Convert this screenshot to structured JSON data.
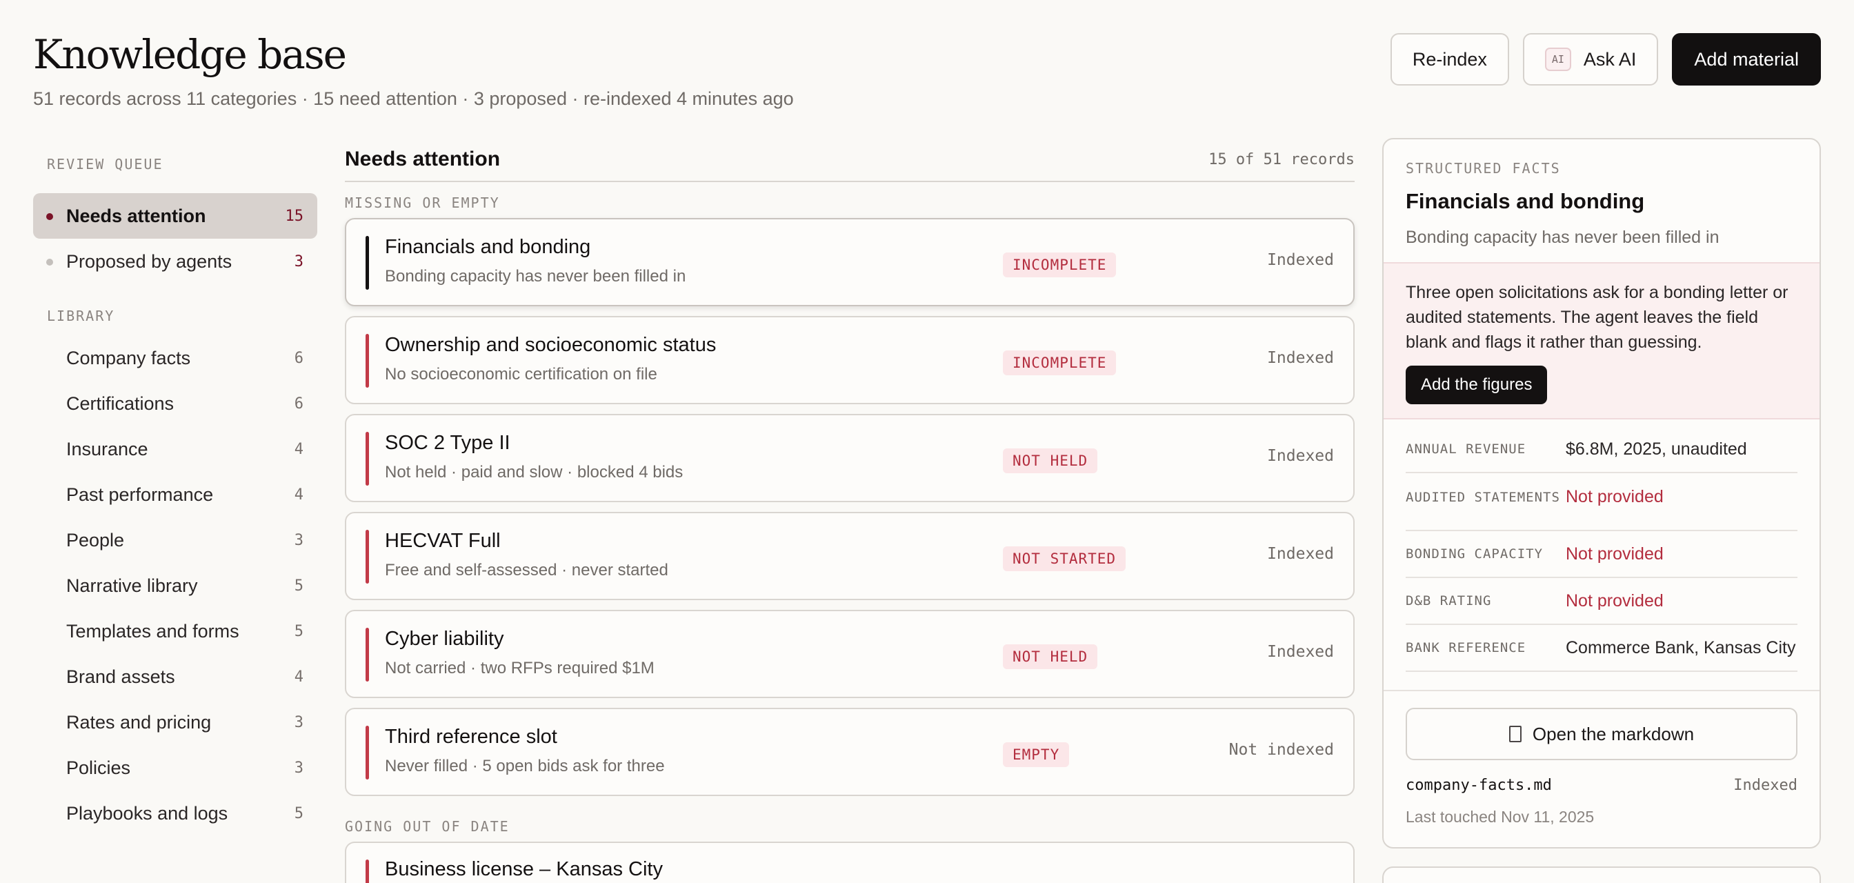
{
  "header": {
    "title": "Knowledge base",
    "subtitle": "51 records across 11 categories · 15 need attention · 3 proposed · re-indexed 4 minutes ago",
    "reindex_label": "Re-index",
    "ai_badge": "AI",
    "ask_ai_label": "Ask AI",
    "add_material_label": "Add material"
  },
  "sidebar": {
    "queue_label": "REVIEW QUEUE",
    "queue": [
      {
        "label": "Needs attention",
        "count": "15"
      },
      {
        "label": "Proposed by agents",
        "count": "3"
      }
    ],
    "library_label": "LIBRARY",
    "library": [
      {
        "label": "Company facts",
        "count": "6"
      },
      {
        "label": "Certifications",
        "count": "6"
      },
      {
        "label": "Insurance",
        "count": "4"
      },
      {
        "label": "Past performance",
        "count": "4"
      },
      {
        "label": "People",
        "count": "3"
      },
      {
        "label": "Narrative library",
        "count": "5"
      },
      {
        "label": "Templates and forms",
        "count": "5"
      },
      {
        "label": "Brand assets",
        "count": "4"
      },
      {
        "label": "Rates and pricing",
        "count": "3"
      },
      {
        "label": "Policies",
        "count": "3"
      },
      {
        "label": "Playbooks and logs",
        "count": "5"
      }
    ]
  },
  "main": {
    "title": "Needs attention",
    "count": "15 of 51 records",
    "group1_label": "MISSING OR EMPTY",
    "group2_label": "GOING OUT OF DATE",
    "records": [
      {
        "title": "Financials and bonding",
        "sub": "Bonding capacity has never been filled in",
        "tag": "INCOMPLETE",
        "state": "Indexed"
      },
      {
        "title": "Ownership and socioeconomic status",
        "sub": "No socioeconomic certification on file",
        "tag": "INCOMPLETE",
        "state": "Indexed"
      },
      {
        "title": "SOC 2 Type II",
        "sub": "Not held · paid and slow · blocked 4 bids",
        "tag": "NOT HELD",
        "state": "Indexed"
      },
      {
        "title": "HECVAT Full",
        "sub": "Free and self-assessed · never started",
        "tag": "NOT STARTED",
        "state": "Indexed"
      },
      {
        "title": "Cyber liability",
        "sub": "Not carried · two RFPs required $1M",
        "tag": "NOT HELD",
        "state": "Indexed"
      },
      {
        "title": "Third reference slot",
        "sub": "Never filled · 5 open bids ask for three",
        "tag": "EMPTY",
        "state": "Not indexed"
      }
    ],
    "partial_title": "Business license – Kansas City"
  },
  "panel": {
    "kicker": "STRUCTURED FACTS",
    "title": "Financials and bonding",
    "subtitle": "Bonding capacity has never been filled in",
    "alert_text": "Three open solicitations ask for a bonding letter or audited statements. The agent leaves the field blank and flags it rather than guessing.",
    "alert_button": "Add the figures",
    "facts": [
      {
        "key": "ANNUAL REVENUE",
        "value": "$6.8M, 2025, unaudited"
      },
      {
        "key": "AUDITED STATEMENTS",
        "value": "Not provided"
      },
      {
        "key": "BONDING CAPACITY",
        "value": "Not provided"
      },
      {
        "key": "D&B RATING",
        "value": "Not provided"
      },
      {
        "key": "BANK REFERENCE",
        "value": "Commerce Bank, Kansas City"
      }
    ],
    "open_label": "Open the markdown",
    "filename": "company-facts.md",
    "file_state": "Indexed",
    "touched": "Last touched Nov 11, 2025"
  }
}
